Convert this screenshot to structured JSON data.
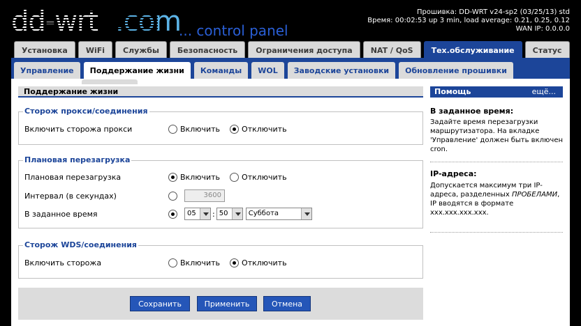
{
  "header": {
    "logo_main": "dd-wrt",
    "logo_com": ".com",
    "logo_tagline": "... control panel",
    "firmware": "Прошивка: DD-WRT v24-sp2 (03/25/13) std",
    "time": "Время: 00:02:53 up 3 min, load average: 0.21, 0.25, 0.12",
    "wan_ip": "WAN IP: 0.0.0.0"
  },
  "main_tabs": [
    {
      "label": "Установка"
    },
    {
      "label": "WiFi"
    },
    {
      "label": "Службы"
    },
    {
      "label": "Безопасность"
    },
    {
      "label": "Ограничения доступа"
    },
    {
      "label": "NAT / QoS"
    },
    {
      "label": "Тех.обслуживание",
      "active": true
    },
    {
      "label": "Статус"
    }
  ],
  "sub_tabs": [
    {
      "label": "Управление"
    },
    {
      "label": "Поддержание жизни",
      "active": true
    },
    {
      "label": "Команды"
    },
    {
      "label": "WOL"
    },
    {
      "label": "Заводские установки"
    },
    {
      "label": "Обновление прошивки"
    }
  ],
  "page": {
    "section_title": "Поддержание жизни",
    "proxy_watchdog": {
      "legend": "Сторож прокси/соединения",
      "label": "Включить сторожа прокси",
      "opt_on": "Включить",
      "opt_off": "Отключить",
      "value": "off"
    },
    "schedule_reboot": {
      "legend": "Плановая перезагрузка",
      "enable_label": "Плановая перезагрузка",
      "opt_on": "Включить",
      "opt_off": "Отключить",
      "enabled": "on",
      "interval_label": "Интервал (в секундах)",
      "interval_value": "3600",
      "time_label": "В заданное время",
      "hour": "05",
      "minute": "50",
      "time_sep": ":",
      "day": "Суббота"
    },
    "wds_watchdog": {
      "legend": "Сторож WDS/соединения",
      "label": "Включить сторожа",
      "opt_on": "Включить",
      "opt_off": "Отключить",
      "value": "off"
    },
    "buttons": {
      "save": "Сохранить",
      "apply": "Применить",
      "cancel": "Отмена"
    }
  },
  "help": {
    "title": "Помощь",
    "more": "ещё...",
    "sections": [
      {
        "title": "В заданное время:",
        "text": "Задайте время перезагрузки маршрутизатора. На вкладке 'Управление' должен быть включен cron."
      },
      {
        "title": "IP-адреса:",
        "text_1": "Допускается максимум три IP-адреса, разделенных",
        "text_em": "ПРОБЕЛАМИ",
        "text_2": "IP вводятся в формате xxx.xxx.xxx.xxx."
      }
    ]
  },
  "colors": {
    "accent": "#1c4599",
    "button": "#2556b8",
    "logo_com": "#5cb3e6",
    "tagline": "#2a5fd6"
  }
}
